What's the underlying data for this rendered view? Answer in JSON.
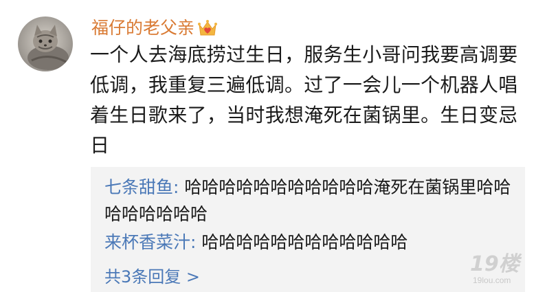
{
  "post": {
    "username": "福仔的老父亲",
    "vip_badge_icon": "crown-heart-icon",
    "text": "一个人去海底捞过生日，服务生小哥问我要高调要低调，我重复三遍低调。过了一会儿一个机器人唱着生日歌来了，当时我想淹死在菌锅里。生日变忌日"
  },
  "replies": [
    {
      "name": "七条甜鱼",
      "separator": ": ",
      "text": "哈哈哈哈哈哈哈哈哈哈哈淹死在菌锅里哈哈哈哈哈哈哈哈"
    },
    {
      "name": "来杯香菜汁",
      "separator": ": ",
      "text": "哈哈哈哈哈哈哈哈哈哈哈哈"
    }
  ],
  "more_replies": "共3条回复 >",
  "watermark": {
    "main": "19楼",
    "sub": "19lou.com"
  },
  "colors": {
    "username": "#d97a33",
    "reply_name": "#4a78b7",
    "reply_bg": "#f3f3f3",
    "text": "#1a1a1a"
  }
}
